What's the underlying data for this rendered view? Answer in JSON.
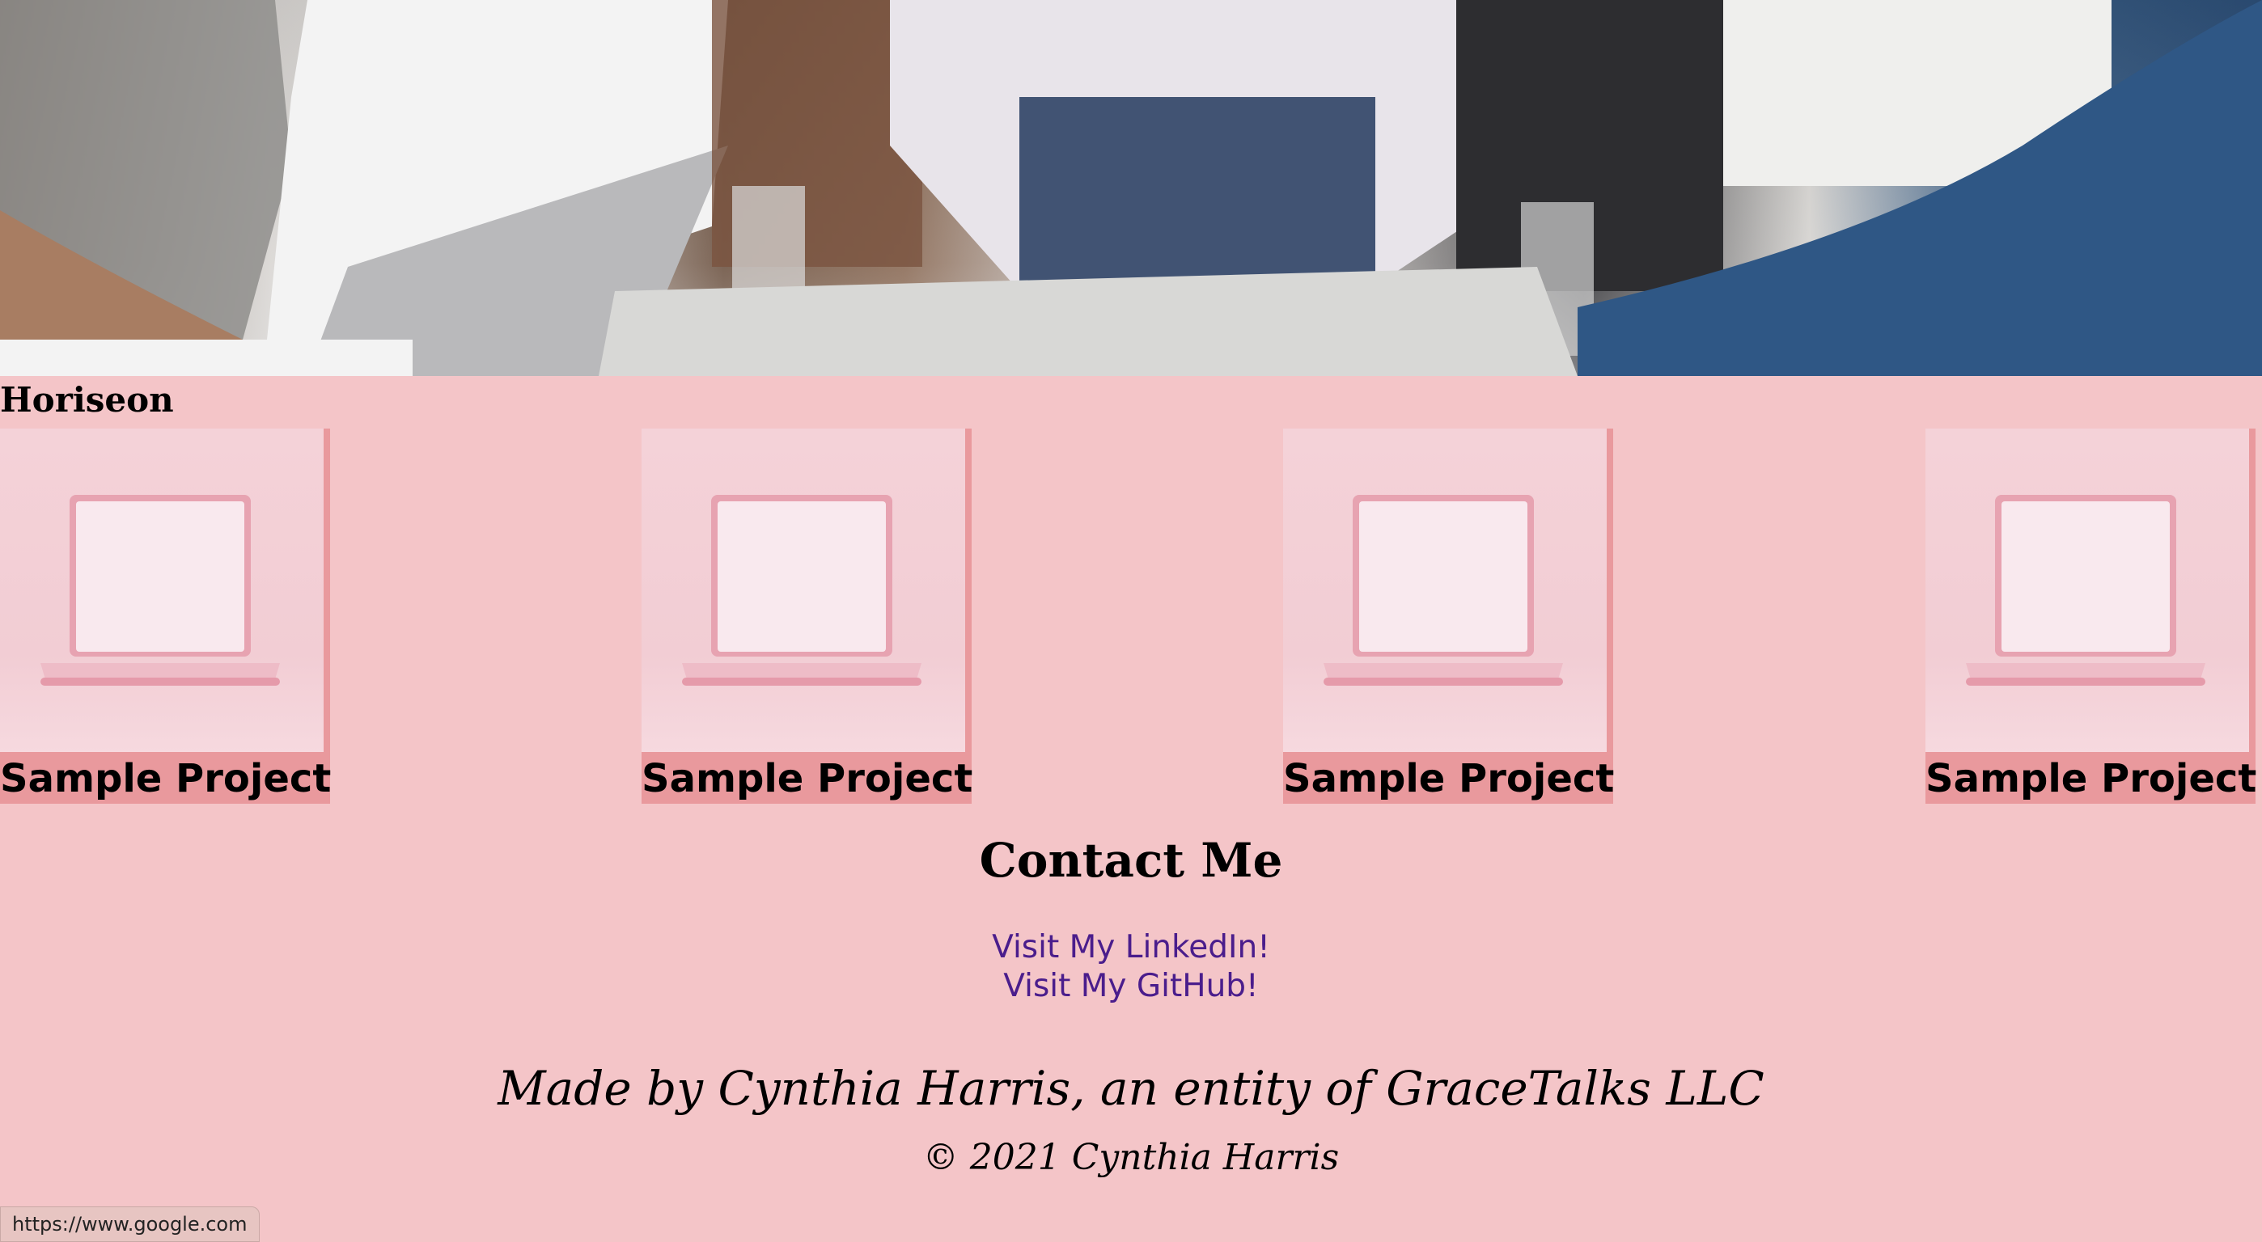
{
  "header": {
    "hero_image": "team-meeting-photo",
    "brand": "Horiseon"
  },
  "projects": [
    {
      "title": "Sample Project",
      "image": "pink-laptop"
    },
    {
      "title": "Sample Project",
      "image": "pink-laptop"
    },
    {
      "title": "Sample Project",
      "image": "pink-laptop"
    },
    {
      "title": "Sample Project",
      "image": "pink-laptop"
    }
  ],
  "contact": {
    "heading": "Contact Me",
    "linkedin": "Visit My LinkedIn!",
    "github": "Visit My GitHub!"
  },
  "footer": {
    "made_by": "Made by Cynthia Harris, an entity of GraceTalks LLC",
    "copyright": "© 2021 Cynthia Harris"
  },
  "status_bar": {
    "url": "https://www.google.com"
  },
  "colors": {
    "page_background": "#f4c5c8",
    "card_background": "#e9999d",
    "link": "#4a1d8c"
  }
}
